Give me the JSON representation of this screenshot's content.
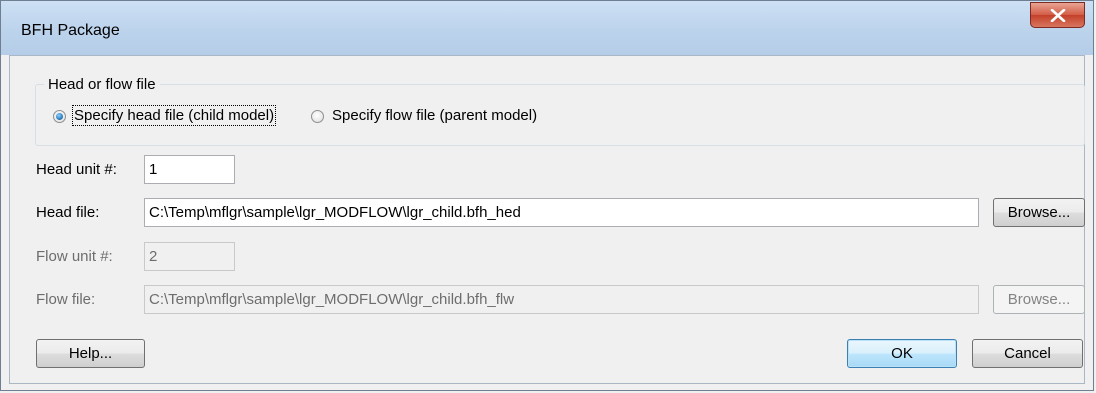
{
  "window": {
    "title": "BFH Package",
    "close_icon": "close-icon"
  },
  "group": {
    "title": "Head or flow file",
    "options": [
      {
        "label": "Specify head file (child model)",
        "checked": true
      },
      {
        "label": "Specify flow file (parent model)",
        "checked": false
      }
    ]
  },
  "fields": {
    "head_unit": {
      "label": "Head unit #:",
      "value": "1",
      "enabled": true
    },
    "head_file": {
      "label": "Head file:",
      "value": "C:\\Temp\\mflgr\\sample\\lgr_MODFLOW\\lgr_child.bfh_hed",
      "enabled": true
    },
    "flow_unit": {
      "label": "Flow unit #:",
      "value": "2",
      "enabled": false
    },
    "flow_file": {
      "label": "Flow file:",
      "value": "C:\\Temp\\mflgr\\sample\\lgr_MODFLOW\\lgr_child.bfh_flw",
      "enabled": false
    }
  },
  "buttons": {
    "browse_head": "Browse...",
    "browse_flow": "Browse...",
    "help": "Help...",
    "ok": "OK",
    "cancel": "Cancel"
  }
}
